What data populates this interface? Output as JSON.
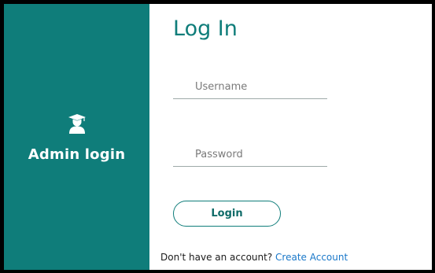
{
  "side_panel": {
    "icon": "graduate-user-icon",
    "label": "Admin login",
    "color": "#0f7d7a"
  },
  "form": {
    "title": "Log In",
    "username": {
      "value": "",
      "placeholder": "Username"
    },
    "password": {
      "value": "",
      "placeholder": "Password"
    },
    "login_label": "Login",
    "signup_prompt": "Don't have an account?",
    "signup_link": "Create Account"
  },
  "colors": {
    "accent": "#0f7d7a",
    "link": "#1a78c9"
  }
}
